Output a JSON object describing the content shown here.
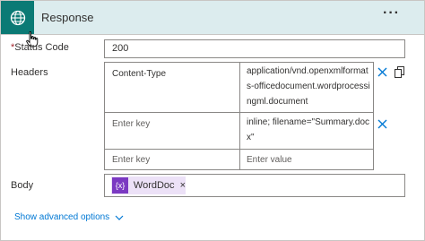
{
  "header": {
    "title": "Response",
    "more_label": "···"
  },
  "status_code": {
    "label": "Status Code",
    "required_marker": "*",
    "value": "200"
  },
  "headers": {
    "label": "Headers",
    "rows": [
      {
        "key": "Content-Type",
        "value_lines": [
          "application/vnd.openxmlformat",
          "s-officedocument.wordprocessi",
          "ngml.document"
        ]
      },
      {
        "key_placeholder": "Enter key",
        "value_lines": [
          "inline; filename=\"Summary.doc",
          "x\""
        ]
      },
      {
        "key_placeholder": "Enter key",
        "value_placeholder": "Enter value"
      }
    ]
  },
  "body": {
    "label": "Body",
    "token_icon_text": "{x}",
    "token_label": "WordDoc",
    "token_remove": "×"
  },
  "advanced": {
    "label": "Show advanced options"
  },
  "icons": {
    "header_icon": "globe-icon",
    "remove_row": "close-icon",
    "chevron": "chevron-down-icon"
  },
  "colors": {
    "header_bg": "#dcecee",
    "icon_tile": "#0b7a75",
    "token_bg": "#ece1f7",
    "token_icon": "#7b39c2",
    "link": "#0078d4"
  }
}
